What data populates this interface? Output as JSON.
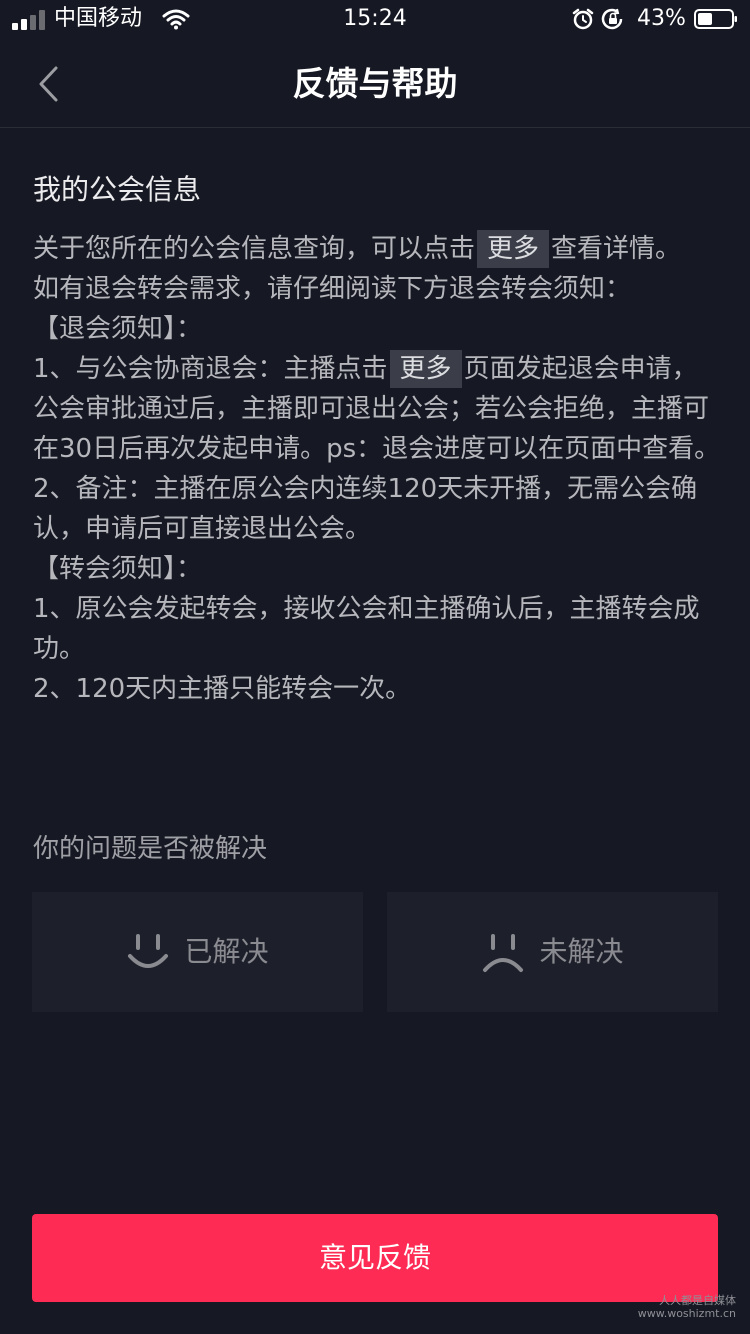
{
  "status_bar": {
    "carrier": "中国移动",
    "time": "15:24",
    "battery_percent": "43%"
  },
  "nav": {
    "title": "反馈与帮助",
    "back_icon": "chevron-left-icon"
  },
  "content": {
    "section_title": "我的公会信息",
    "p1_a": "关于您所在的公会信息查询，可以点击",
    "more_label": "更多",
    "p1_b": "查看详情。",
    "p2": "如有退会转会需求，请仔细阅读下方退会转会须知：",
    "p3": "【退会须知】：",
    "p4_a": "1、与公会协商退会：主播点击",
    "p4_b": "页面发起退会申请，公会审批通过后，主播即可退出公会；若公会拒绝，主播可在30日后再次发起申请。ps：退会进度可以在页面中查看。",
    "p5": "2、备注：主播在原公会内连续120天未开播，无需公会确认，申请后可直接退出公会。",
    "p6": "【转会须知】：",
    "p7": "1、原公会发起转会，接收公会和主播确认后，主播转会成功。",
    "p8": "2、120天内主播只能转会一次。"
  },
  "feedback_question": {
    "label": "你的问题是否被解决",
    "resolved_label": "已解决",
    "unresolved_label": "未解决"
  },
  "feedback_button": {
    "label": "意见反馈"
  },
  "watermark": {
    "line1": "人人都是自媒体",
    "line2": "www.woshizmt.cn"
  },
  "colors": {
    "background": "#161823",
    "accent": "#fe2c55"
  }
}
